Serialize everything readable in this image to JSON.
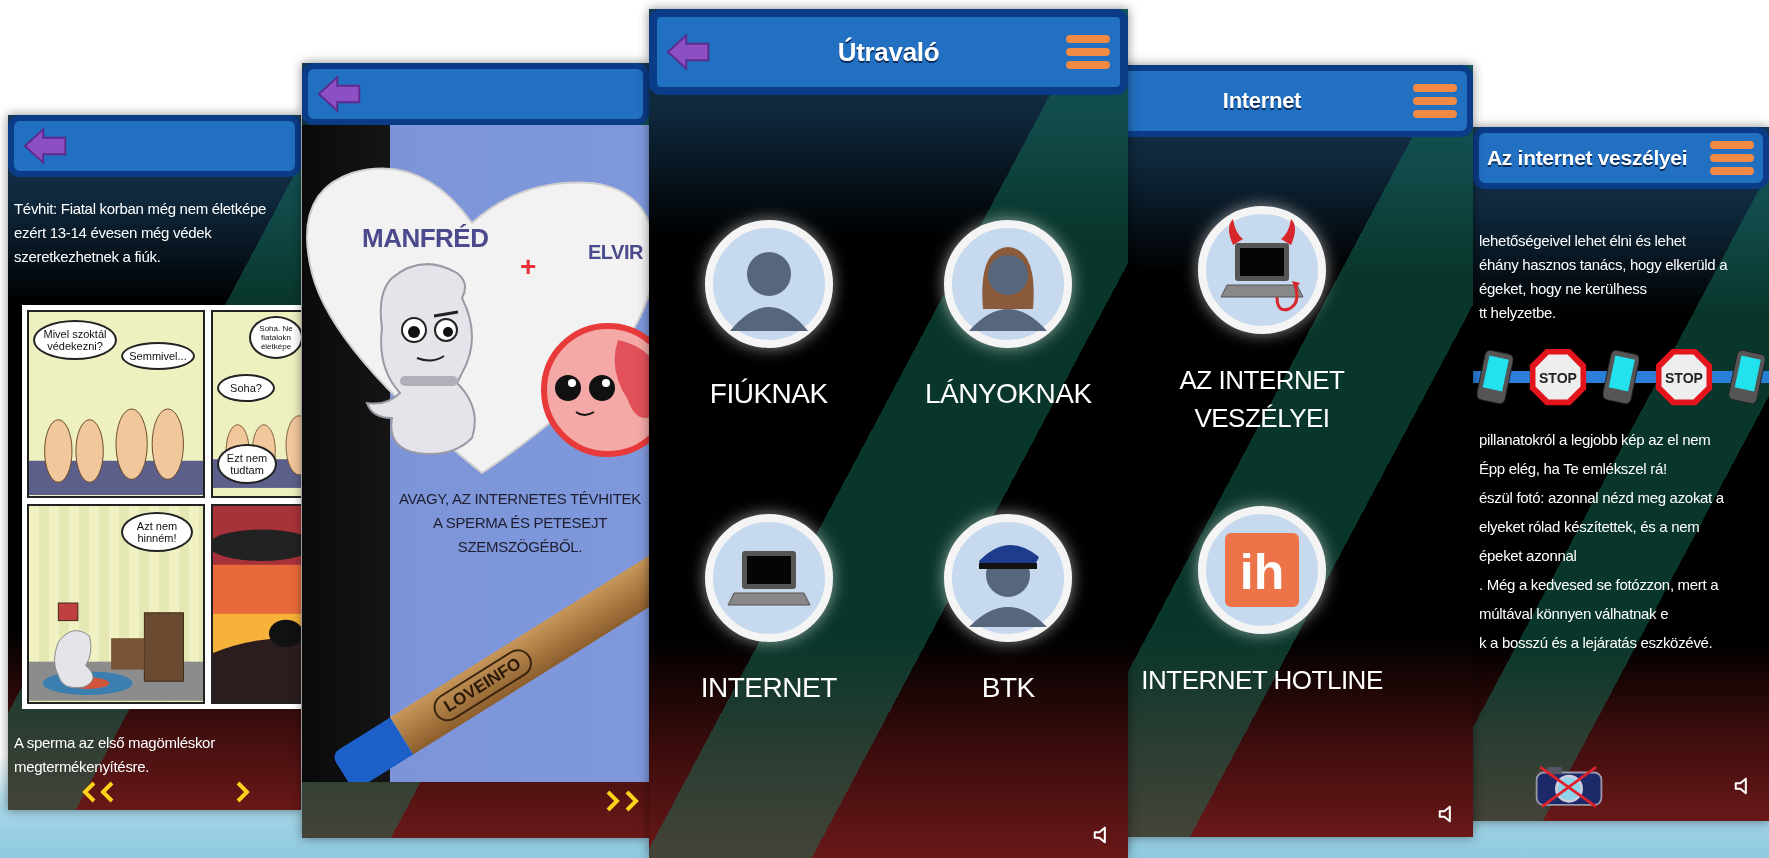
{
  "screens": [
    {
      "kind": "comic",
      "back_button": true,
      "menu_button": false,
      "sound_button": false,
      "intro": [
        "Tévhit: Fiatal korban még nem életképe",
        "ezért 13-14 évesen még védek",
        "szeretkezhetnek a fiúk."
      ],
      "panels": [
        {
          "bubbles": [
            "Mivel szoktál védekezni?",
            "Semmivel..."
          ]
        },
        {
          "bubbles": [
            "Soha. Ne fiatalokn életképe",
            "Soha?",
            "Ezt nem tudtam"
          ]
        },
        {
          "bubbles": [
            "Azt nem hinném!"
          ]
        }
      ],
      "outro": [
        "A sperma az első magömléskor",
        "megtermékenyítésre."
      ]
    },
    {
      "kind": "poster",
      "back_button": true,
      "menu_button": false,
      "sound_button": false,
      "left_name": "MANFRÉD",
      "plus": "+",
      "right_name": "ELVIR",
      "caption": "AVAGY, AZ INTERNETES TÉVHITEK A SPERMA ÉS PETESEJT SZEMSZÖGÉBŐL.",
      "crayon_label": "LOVEINFO"
    },
    {
      "kind": "menu",
      "back_button": true,
      "menu_button": true,
      "sound_button": true,
      "title": "Útravaló",
      "items": [
        {
          "label": "FIÚKNAK"
        },
        {
          "label": "LÁNYOKNAK"
        },
        {
          "label": "INTERNET"
        },
        {
          "label": "BTK"
        }
      ]
    },
    {
      "kind": "menu",
      "back_button": false,
      "menu_button": true,
      "sound_button": true,
      "title": "Internet",
      "items": [
        {
          "label": "AZ INTERNET VESZÉLYEI"
        },
        {
          "label": "INTERNET HOTLINE",
          "logo": "ih"
        }
      ]
    },
    {
      "kind": "article",
      "back_button": false,
      "menu_button": true,
      "sound_button": true,
      "title": "Az internet veszélyei",
      "paragraphs": [
        [
          "lehetőségeivel lehet élni és lehet",
          "éhány hasznos tanács, hogy elkerüld a",
          "égeket, hogy ne kerülhess",
          "tt helyzetbe."
        ],
        [
          "pillanatokról a legjobb kép az el nem",
          "Épp elég, ha Te emlékszel rá!",
          "észül fotó: azonnal nézd meg azokat a",
          "elyeket rólad készítettek, és a nem",
          "épeket azonnal",
          ". Még a kedvesed se fotózzon, mert a",
          "múltával könnyen válhatnak e",
          "k a bosszú és a lejáratás eszközévé."
        ]
      ],
      "stop_signs": [
        "STOP",
        "STOP"
      ]
    }
  ]
}
